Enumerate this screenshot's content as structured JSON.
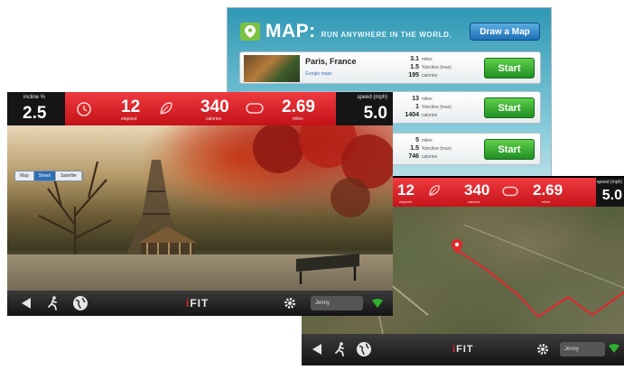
{
  "map_panel": {
    "title": "MAP:",
    "tagline": "RUN ANYWHERE IN THE WORLD.",
    "draw_button": "Draw a Map",
    "routes": [
      {
        "place": "Paris, France",
        "credit": "Google maps",
        "stats": [
          {
            "value": "3.1",
            "unit": "miles"
          },
          {
            "value": "1.5",
            "unit": "%incline (max)"
          },
          {
            "value": "195",
            "unit": "calories"
          }
        ],
        "start": "Start"
      },
      {
        "place": "",
        "credit": "",
        "stats": [
          {
            "value": "13",
            "unit": "miles"
          },
          {
            "value": "1",
            "unit": "%incline (max)"
          },
          {
            "value": "1404",
            "unit": "calories"
          }
        ],
        "start": "Start"
      },
      {
        "place": "",
        "credit": "",
        "stats": [
          {
            "value": "5",
            "unit": "miles"
          },
          {
            "value": "1.5",
            "unit": "%incline (max)"
          },
          {
            "value": "746",
            "unit": "calories"
          }
        ],
        "start": "Start"
      }
    ]
  },
  "left_screen": {
    "incline_label": "incline %",
    "incline_value": "2.5",
    "elapsed_value": "12",
    "elapsed_label": "elapsed",
    "calories_value": "340",
    "calories_label": "calories",
    "miles_value": "2.69",
    "miles_label": "miles",
    "speed_label": "speed (mph)",
    "speed_value": "5.0",
    "mode_tabs": [
      "Map",
      "Street",
      "Satellite"
    ],
    "mode_selected": "Street",
    "logo_i": "i",
    "logo_rest": "FIT",
    "user": "Jenny"
  },
  "right_screen": {
    "elapsed_value": "12",
    "elapsed_label": "elapsed",
    "calories_value": "340",
    "calories_label": "calories",
    "miles_value": "2.69",
    "miles_label": "miles",
    "speed_label": "speed (mph)",
    "speed_value": "5.0",
    "logo_i": "i",
    "logo_rest": "FIT",
    "user": "Jenny"
  },
  "colors": {
    "red": "#e2262c",
    "green": "#2fae2f",
    "blue": "#2d6fb4",
    "dark": "#151515"
  }
}
